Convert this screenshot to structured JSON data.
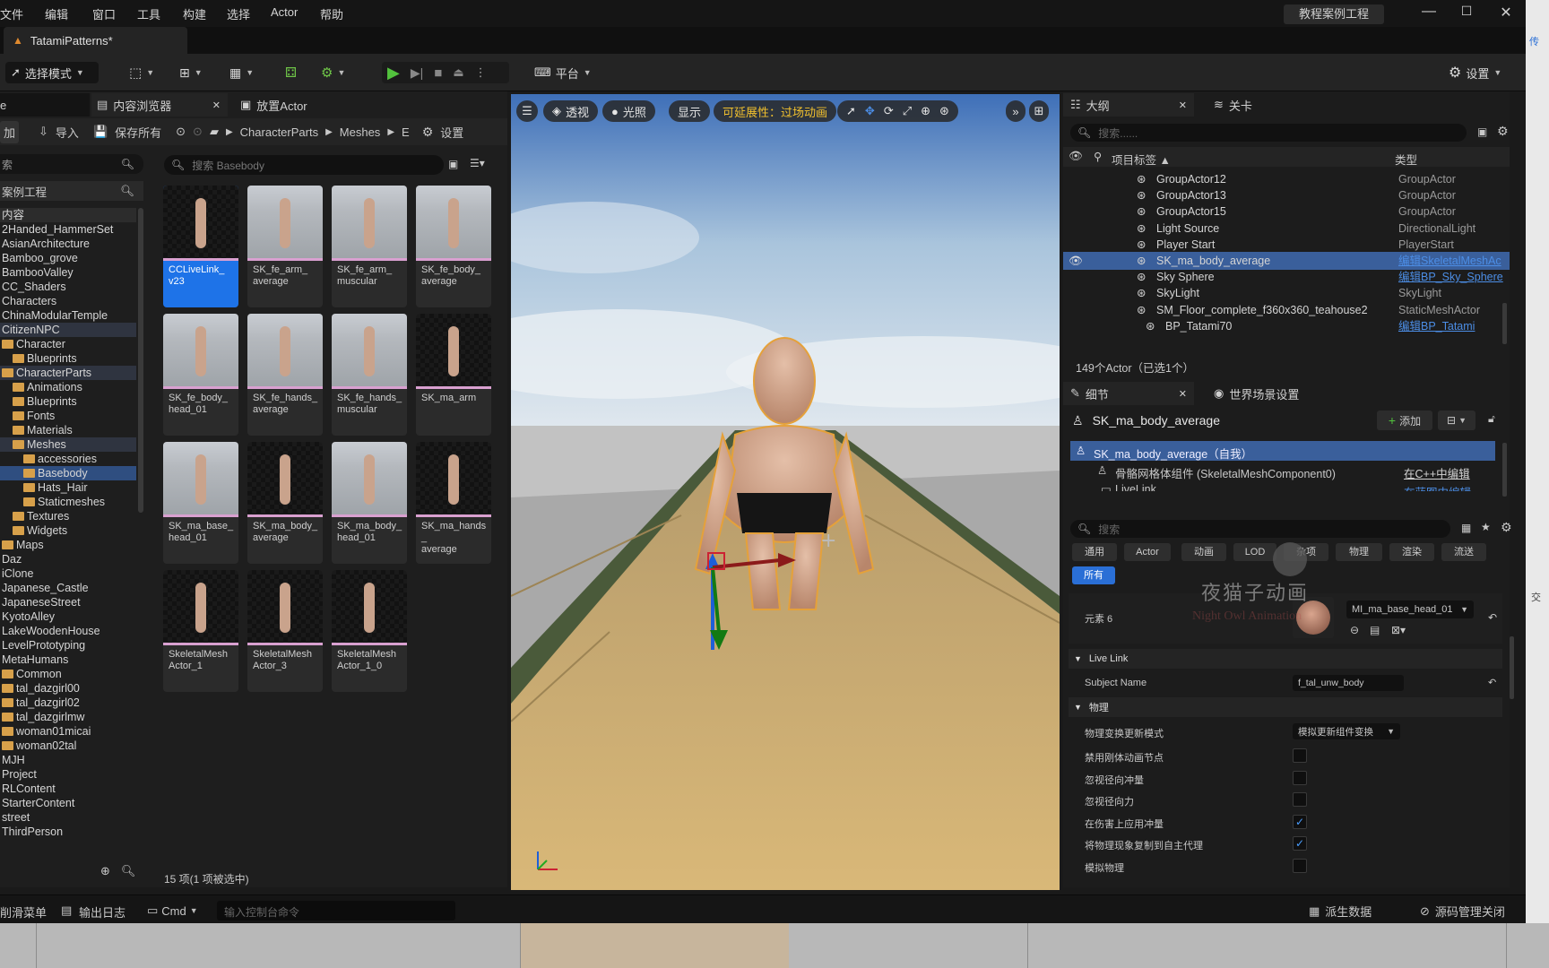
{
  "menu": {
    "items": [
      "文件",
      "编辑",
      "窗口",
      "工具",
      "构建",
      "选择",
      "Actor",
      "帮助"
    ],
    "project_title": "教程案例工程"
  },
  "window_controls": {
    "minimize": "—",
    "maximize": "☐",
    "close": "✕"
  },
  "document_tab": {
    "label": "TatamiPatterns*"
  },
  "toolbar": {
    "select_mode": "选择模式",
    "platform": "平台",
    "settings": "设置"
  },
  "content_browser": {
    "tab_prev_fragment": "e",
    "tab_label": "内容浏览器",
    "place_actor_tab": "放置Actor",
    "add_fragment": "加",
    "import": "导入",
    "save_all": "保存所有",
    "breadcrumb": [
      "CharacterParts",
      "Meshes",
      "E"
    ],
    "settings": "设置",
    "search_fragment": "索",
    "project_search": "案例工程",
    "asset_search_placeholder": "搜索 Basebody",
    "status": "15 项(1 项被选中)",
    "tree": [
      {
        "label": "内容",
        "indent": 0,
        "folder": false,
        "hl": "root"
      },
      {
        "label": "2Handed_HammerSet",
        "indent": 0,
        "folder": false
      },
      {
        "label": "AsianArchitecture",
        "indent": 0,
        "folder": false
      },
      {
        "label": "Bamboo_grove",
        "indent": 0,
        "folder": false
      },
      {
        "label": "BambooValley",
        "indent": 0,
        "folder": false
      },
      {
        "label": "CC_Shaders",
        "indent": 0,
        "folder": false
      },
      {
        "label": "Characters",
        "indent": 0,
        "folder": false
      },
      {
        "label": "ChinaModularTemple",
        "indent": 0,
        "folder": false
      },
      {
        "label": "CitizenNPC",
        "indent": 0,
        "folder": false,
        "hl": "soft"
      },
      {
        "label": "Character",
        "indent": 0,
        "folder": true
      },
      {
        "label": "Blueprints",
        "indent": 1,
        "folder": true
      },
      {
        "label": "CharacterParts",
        "indent": 0,
        "folder": true,
        "hl": "soft"
      },
      {
        "label": "Animations",
        "indent": 1,
        "folder": true
      },
      {
        "label": "Blueprints",
        "indent": 1,
        "folder": true
      },
      {
        "label": "Fonts",
        "indent": 1,
        "folder": true
      },
      {
        "label": "Materials",
        "indent": 1,
        "folder": true
      },
      {
        "label": "Meshes",
        "indent": 1,
        "folder": true,
        "hl": "soft"
      },
      {
        "label": "accessories",
        "indent": 2,
        "folder": true
      },
      {
        "label": "Basebody",
        "indent": 2,
        "folder": true,
        "hl": "sel"
      },
      {
        "label": "Hats_Hair",
        "indent": 2,
        "folder": true
      },
      {
        "label": "Staticmeshes",
        "indent": 2,
        "folder": true
      },
      {
        "label": "Textures",
        "indent": 1,
        "folder": true
      },
      {
        "label": "Widgets",
        "indent": 1,
        "folder": true
      },
      {
        "label": "Maps",
        "indent": 0,
        "folder": true
      },
      {
        "label": "Daz",
        "indent": 0,
        "folder": false
      },
      {
        "label": "iClone",
        "indent": 0,
        "folder": false
      },
      {
        "label": "Japanese_Castle",
        "indent": 0,
        "folder": false
      },
      {
        "label": "JapaneseStreet",
        "indent": 0,
        "folder": false
      },
      {
        "label": "KyotoAlley",
        "indent": 0,
        "folder": false
      },
      {
        "label": "LakeWoodenHouse",
        "indent": 0,
        "folder": false
      },
      {
        "label": "LevelPrototyping",
        "indent": 0,
        "folder": false
      },
      {
        "label": "MetaHumans",
        "indent": 0,
        "folder": false
      },
      {
        "label": "Common",
        "indent": 0,
        "folder": true
      },
      {
        "label": "tal_dazgirl00",
        "indent": 0,
        "folder": true
      },
      {
        "label": "tal_dazgirl02",
        "indent": 0,
        "folder": true
      },
      {
        "label": "tal_dazgirlmw",
        "indent": 0,
        "folder": true
      },
      {
        "label": "woman01micai",
        "indent": 0,
        "folder": true
      },
      {
        "label": "woman02tal",
        "indent": 0,
        "folder": true
      },
      {
        "label": "MJH",
        "indent": 0,
        "folder": false
      },
      {
        "label": "Project",
        "indent": 0,
        "folder": false
      },
      {
        "label": "RLContent",
        "indent": 0,
        "folder": false
      },
      {
        "label": "StarterContent",
        "indent": 0,
        "folder": false
      },
      {
        "label": "street",
        "indent": 0,
        "folder": false
      },
      {
        "label": "ThirdPerson",
        "indent": 0,
        "folder": false
      }
    ],
    "assets": [
      {
        "name": "CCLiveLink_\nv23",
        "thumb": "dark",
        "selected": true
      },
      {
        "name": "SK_fe_arm_\naverage",
        "thumb": "floor"
      },
      {
        "name": "SK_fe_arm_\nmuscular",
        "thumb": "floor"
      },
      {
        "name": "SK_fe_body_\naverage",
        "thumb": "floor"
      },
      {
        "name": "SK_fe_body_\nhead_01",
        "thumb": "floor"
      },
      {
        "name": "SK_fe_hands_\naverage",
        "thumb": "floor"
      },
      {
        "name": "SK_fe_hands_\nmuscular",
        "thumb": "floor"
      },
      {
        "name": "SK_ma_arm",
        "thumb": "dark"
      },
      {
        "name": "SK_ma_base_\nhead_01",
        "thumb": "floor"
      },
      {
        "name": "SK_ma_body_\naverage",
        "thumb": "dark"
      },
      {
        "name": "SK_ma_body_\nhead_01",
        "thumb": "floor"
      },
      {
        "name": "SK_ma_hands_\naverage",
        "thumb": "dark"
      },
      {
        "name": "SkeletalMesh\nActor_1",
        "thumb": "dark"
      },
      {
        "name": "SkeletalMesh\nActor_3",
        "thumb": "dark"
      },
      {
        "name": "SkeletalMesh\nActor_1_0",
        "thumb": "dark"
      }
    ]
  },
  "viewport": {
    "perspective": "透视",
    "lighting": "光照",
    "show": "显示",
    "scalability": "可延展性：过场动画"
  },
  "outliner": {
    "tab": "大纲",
    "levels_tab": "关卡",
    "search_placeholder": "搜索......",
    "col_label": "项目标签 ▲",
    "col_type": "类型",
    "rows": [
      {
        "name": "GroupActor12",
        "type": "GroupActor",
        "indent": 0,
        "link": false
      },
      {
        "name": "GroupActor13",
        "type": "GroupActor",
        "indent": 0,
        "link": false
      },
      {
        "name": "GroupActor15",
        "type": "GroupActor",
        "indent": 0,
        "link": false
      },
      {
        "name": "Light Source",
        "type": "DirectionalLight",
        "indent": 0,
        "link": false
      },
      {
        "name": "Player Start",
        "type": "PlayerStart",
        "indent": 0,
        "link": false
      },
      {
        "name": "SK_ma_body_average",
        "type": "编辑SkeletalMeshAc",
        "indent": 0,
        "link": true,
        "selected": true
      },
      {
        "name": "Sky Sphere",
        "type": "编辑BP_Sky_Sphere",
        "indent": 0,
        "link": true
      },
      {
        "name": "SkyLight",
        "type": "SkyLight",
        "indent": 0,
        "link": false
      },
      {
        "name": "SM_Floor_complete_f360x360_teahouse2",
        "type": "StaticMeshActor",
        "indent": 0,
        "link": false
      },
      {
        "name": "BP_Tatami70",
        "type": "编辑BP_Tatami",
        "indent": 1,
        "link": true
      }
    ],
    "count": "149个Actor（已选1个）"
  },
  "details": {
    "tab": "细节",
    "world_tab": "世界场景设置",
    "actor_name": "SK_ma_body_average",
    "add": "添加",
    "comp_self": "SK_ma_body_average（自我）",
    "comp_mesh": "骨骼网格体组件 (SkeletalMeshComponent0)",
    "comp_edit": "在C++中编辑",
    "comp_livelink": "LiveLink",
    "comp_bp": "在蓝图中编辑",
    "search_placeholder": "搜索",
    "filters": [
      "通用",
      "Actor",
      "动画",
      "LOD",
      "杂项",
      "物理",
      "渲染",
      "流送",
      "所有"
    ],
    "element_label": "元素 6",
    "material": "MI_ma_base_head_01",
    "sec_livelink": "Live Link",
    "subject_label": "Subject Name",
    "subject_value": "f_tal_unw_body",
    "sec_physics": "物理",
    "phys_mode_label": "物理变换更新模式",
    "phys_mode_value": "模拟更新组件变换",
    "physics_rows": [
      {
        "label": "禁用刚体动画节点",
        "checked": false
      },
      {
        "label": "忽视径向冲量",
        "checked": false
      },
      {
        "label": "忽视径向力",
        "checked": false
      },
      {
        "label": "在伤害上应用冲量",
        "checked": true
      },
      {
        "label": "将物理现象复制到自主代理",
        "checked": true
      },
      {
        "label": "模拟物理",
        "checked": false
      }
    ]
  },
  "watermark": {
    "line1": "夜猫子动画",
    "line2": "Night Owl Animation"
  },
  "statusbar": {
    "drawer": "削滑菜单",
    "output_log": "输出日志",
    "cmd": "Cmd",
    "console_placeholder": "输入控制台命令",
    "derived_data": "派生数据",
    "source_control": "源码管理关闭"
  },
  "side_fragments": {
    "top": "传",
    "mid": "交"
  }
}
